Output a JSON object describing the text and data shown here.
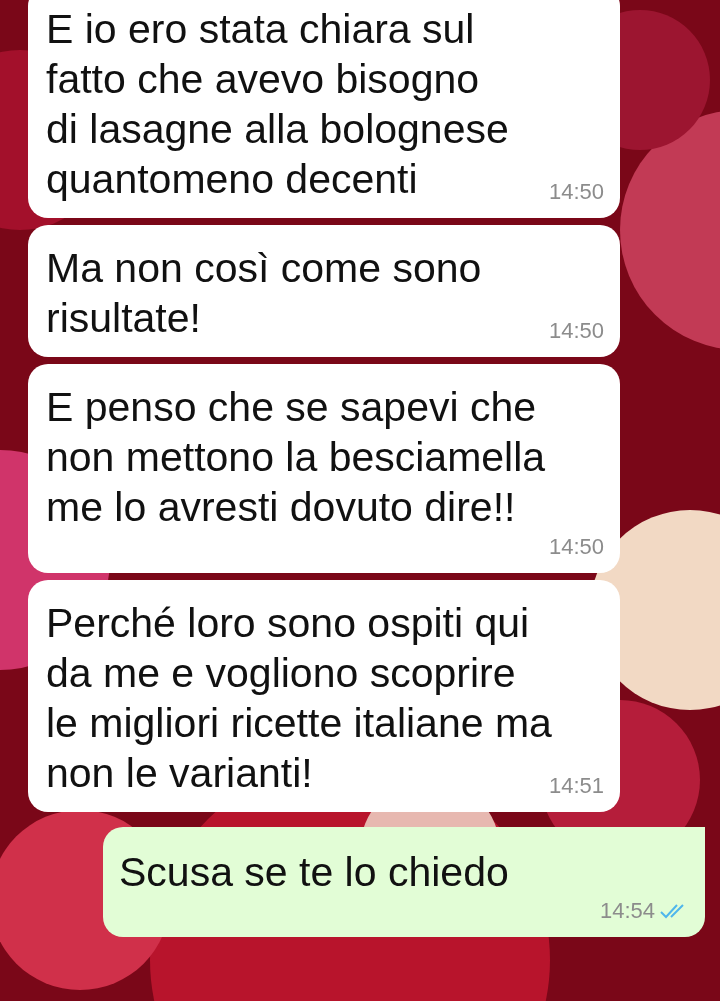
{
  "messages": [
    {
      "kind": "incoming",
      "text": "E io ero stata chiara sul\nfatto che avevo bisogno\ndi lasagne alla bolognese\nquantomeno decenti",
      "time": "14:50"
    },
    {
      "kind": "incoming",
      "text": "Ma non così come sono\nrisultate!",
      "time": "14:50"
    },
    {
      "kind": "incoming",
      "text": "E penso che se sapevi che\nnon mettono la besciamella\nme lo avresti dovuto dire!!",
      "time": "14:50"
    },
    {
      "kind": "incoming",
      "text": "Perché loro sono ospiti qui\nda me e vogliono scoprire\nle migliori ricette italiane ma\nnon le varianti!",
      "time": "14:51"
    },
    {
      "kind": "outgoing",
      "text": "Scusa se te lo chiedo",
      "time": "14:54",
      "read": true
    }
  ]
}
